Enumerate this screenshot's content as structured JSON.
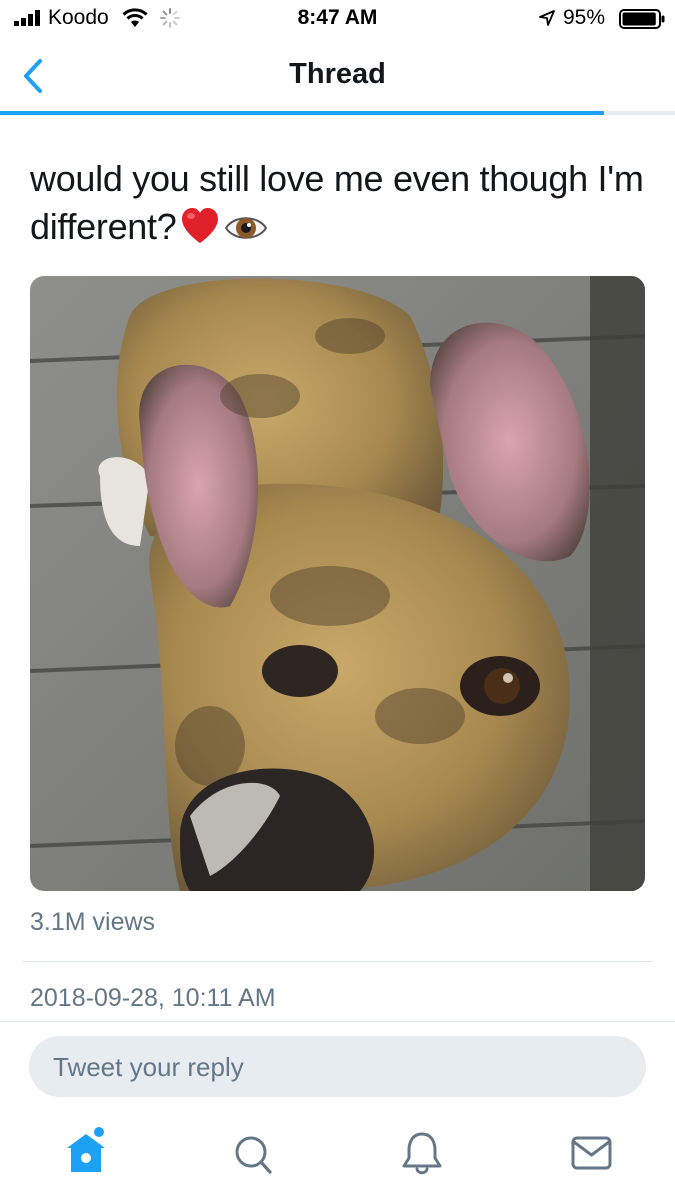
{
  "status_bar": {
    "carrier": "Koodo",
    "time": "8:47 AM",
    "battery_percent": "95%",
    "battery_level": 0.95
  },
  "nav": {
    "title": "Thread",
    "back_icon": "chevron-left-icon",
    "load_progress": 0.895
  },
  "tweet": {
    "text": "would you still love me even though I'm different?",
    "emojis": [
      "red-heart-emoji",
      "eye-emoji"
    ],
    "media_alt_icon": "dog-photo",
    "views": "3.1M views",
    "timestamp": "2018-09-28, 10:11 AM"
  },
  "reply": {
    "placeholder": "Tweet your reply"
  },
  "tab_bar": {
    "items": [
      "home-icon",
      "search-icon",
      "notifications-icon",
      "messages-icon"
    ],
    "active": "home-icon"
  },
  "colors": {
    "accent": "#1da1f2",
    "text": "#14171a",
    "muted": "#657786",
    "divider": "#e1e8ed",
    "reply_bg": "#e6ecf0"
  }
}
